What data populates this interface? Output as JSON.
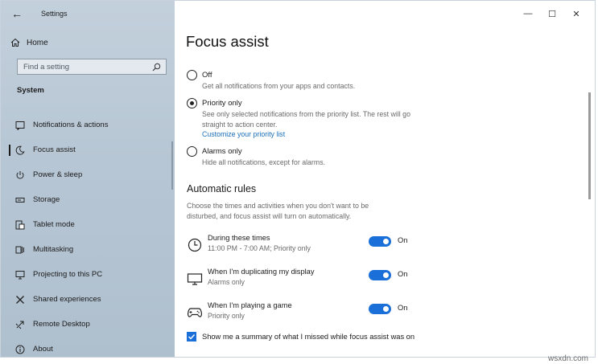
{
  "window": {
    "app_title": "Settings",
    "controls": {
      "minimize": "—",
      "maximize": "☐",
      "close": "✕"
    }
  },
  "sidebar": {
    "back_glyph": "←",
    "home_label": "Home",
    "search_placeholder": "Find a setting",
    "section_label": "System",
    "items": [
      {
        "label": "Notifications & actions",
        "icon": "notifications-icon"
      },
      {
        "label": "Focus assist",
        "icon": "focus-moon-icon",
        "active": true
      },
      {
        "label": "Power & sleep",
        "icon": "power-icon"
      },
      {
        "label": "Storage",
        "icon": "storage-icon"
      },
      {
        "label": "Tablet mode",
        "icon": "tablet-mode-icon"
      },
      {
        "label": "Multitasking",
        "icon": "multitasking-icon"
      },
      {
        "label": "Projecting to this PC",
        "icon": "projecting-icon"
      },
      {
        "label": "Shared experiences",
        "icon": "shared-experiences-icon"
      },
      {
        "label": "Remote Desktop",
        "icon": "remote-desktop-icon"
      },
      {
        "label": "About",
        "icon": "info-icon"
      }
    ]
  },
  "main": {
    "title": "Focus assist",
    "options": [
      {
        "label": "Off",
        "desc": "Get all notifications from your apps and contacts.",
        "checked": false
      },
      {
        "label": "Priority only",
        "desc": "See only selected notifications from the priority list. The rest will go straight to action center.",
        "link": "Customize your priority list",
        "checked": true
      },
      {
        "label": "Alarms only",
        "desc": "Hide all notifications, except for alarms.",
        "checked": false
      }
    ],
    "rules_title": "Automatic rules",
    "rules_desc": "Choose the times and activities when you don't want to be disturbed, and focus assist will turn on automatically.",
    "rules": [
      {
        "title": "During these times",
        "sub": "11:00 PM - 7:00 AM; Priority only",
        "state": "On",
        "icon": "clock-icon"
      },
      {
        "title": "When I'm duplicating my display",
        "sub": "Alarms only",
        "state": "On",
        "icon": "monitor-icon"
      },
      {
        "title": "When I'm playing a game",
        "sub": "Priority only",
        "state": "On",
        "icon": "gamepad-icon"
      }
    ],
    "summary_checkbox": {
      "label": "Show me a summary of what I missed while focus assist was on",
      "checked": true
    }
  },
  "watermark": "wsxdn.com",
  "colors": {
    "accent": "#1a6fd8",
    "link": "#1a6fba",
    "sidebar_bg": "#b7c6d4"
  }
}
